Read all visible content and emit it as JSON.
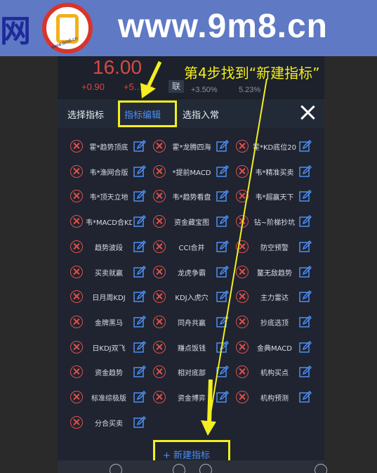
{
  "watermark": {
    "left_text": "网",
    "url": "www.9m8.cn",
    "logo_small": "www.9m8.cn"
  },
  "stock": {
    "price": "16.00",
    "change": "+0.90",
    "change_pct": "+5.…%",
    "sub1": "+3.50%",
    "sub2": "5.23%",
    "badge": "联"
  },
  "annotation": "第4步找到“新建指标”",
  "tabs": [
    {
      "label": "选择指标"
    },
    {
      "label": "指标编辑",
      "active": true
    },
    {
      "label": "选指入常"
    }
  ],
  "indicators": [
    [
      "霍*趋势顶底",
      "霍*龙腾四海",
      "霍*KD底位20"
    ],
    [
      "韦*渔网合版",
      "*提前MACD",
      "韦*精准买卖"
    ],
    [
      "韦*顶天立地",
      "韦*趋势看盘",
      "韦*超赢天下"
    ],
    [
      "韦*MACD合KD",
      "资金藏宝图",
      "钻~阶梯抄坑"
    ],
    [
      "趋势波段",
      "CCI合并",
      "防空预警"
    ],
    [
      "买卖就赢",
      "龙虎争霸",
      "鳌无敌趋势"
    ],
    [
      "日月周KDJ",
      "KDJ入虎穴",
      "主力雷达"
    ],
    [
      "金牌黑马",
      "同舟共赢",
      "抄底选顶"
    ],
    [
      "日KDJ双飞",
      "赚点饭钱",
      "金典MACD"
    ],
    [
      "资金趋势",
      "相对底部",
      "机构买点"
    ],
    [
      "标准综极版",
      "资金博弈",
      "机构预测"
    ],
    [
      "分合买卖"
    ]
  ],
  "new_indicator_label": "+ 新建指标",
  "colors": {
    "accent": "#4d8ef5",
    "highlight": "#f4ef1e",
    "delete": "#e0504a"
  }
}
